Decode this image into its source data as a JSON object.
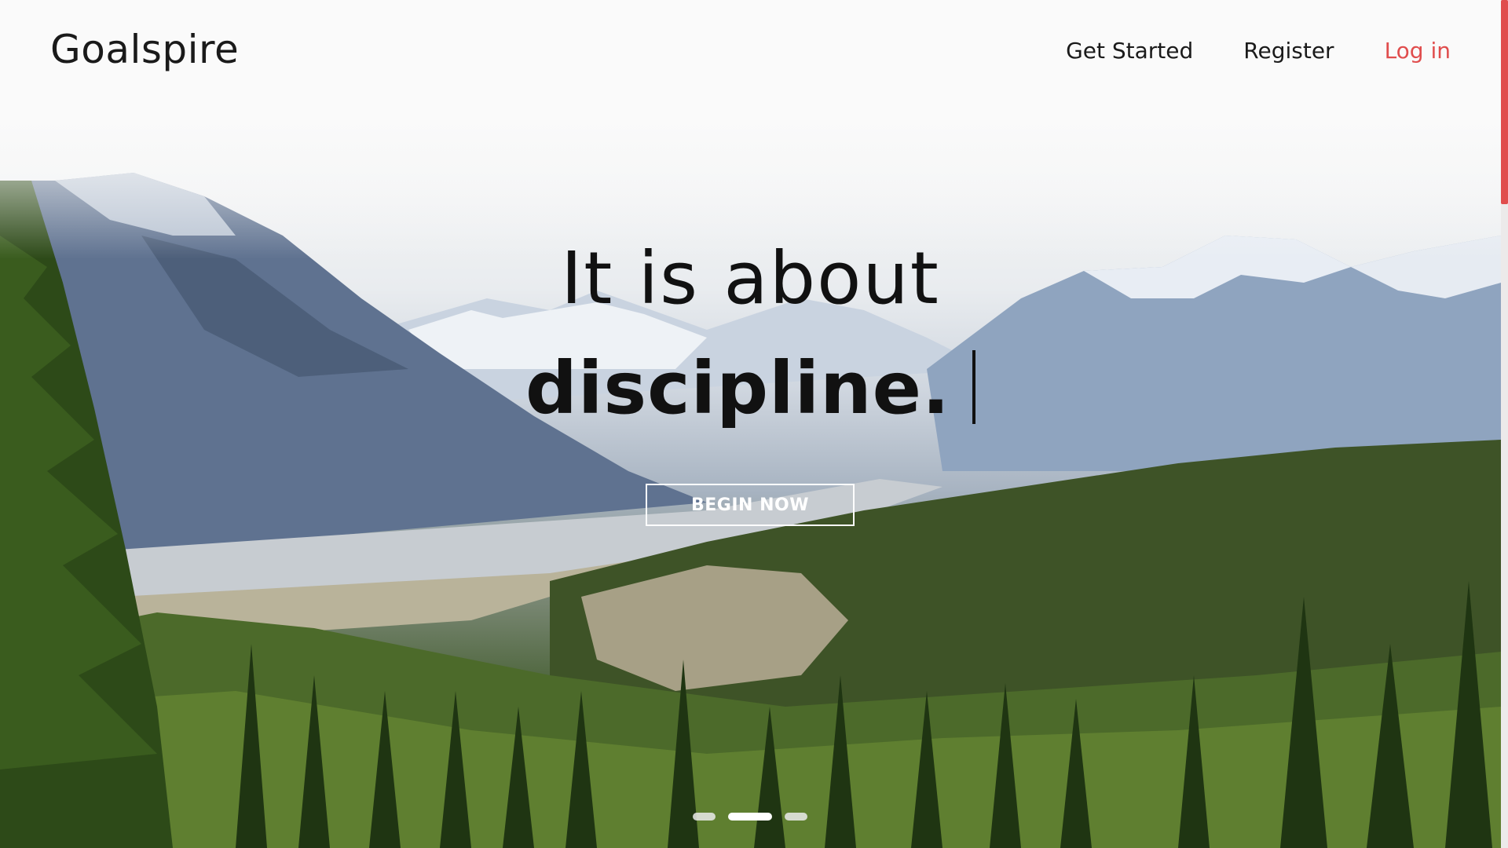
{
  "brand": {
    "name": "Goalspire"
  },
  "nav": {
    "items": [
      {
        "label": "Get Started"
      },
      {
        "label": "Register"
      },
      {
        "label": "Log in"
      }
    ],
    "accent_color": "#e04d4d"
  },
  "hero": {
    "line1": "It is about",
    "line2": "discipline.",
    "cta_label": "BEGIN NOW",
    "background": "mountain-forest-landscape"
  },
  "carousel": {
    "slide_count": 3,
    "active_index": 1
  },
  "scrollbar": {
    "thumb_color": "#e04d4d"
  }
}
